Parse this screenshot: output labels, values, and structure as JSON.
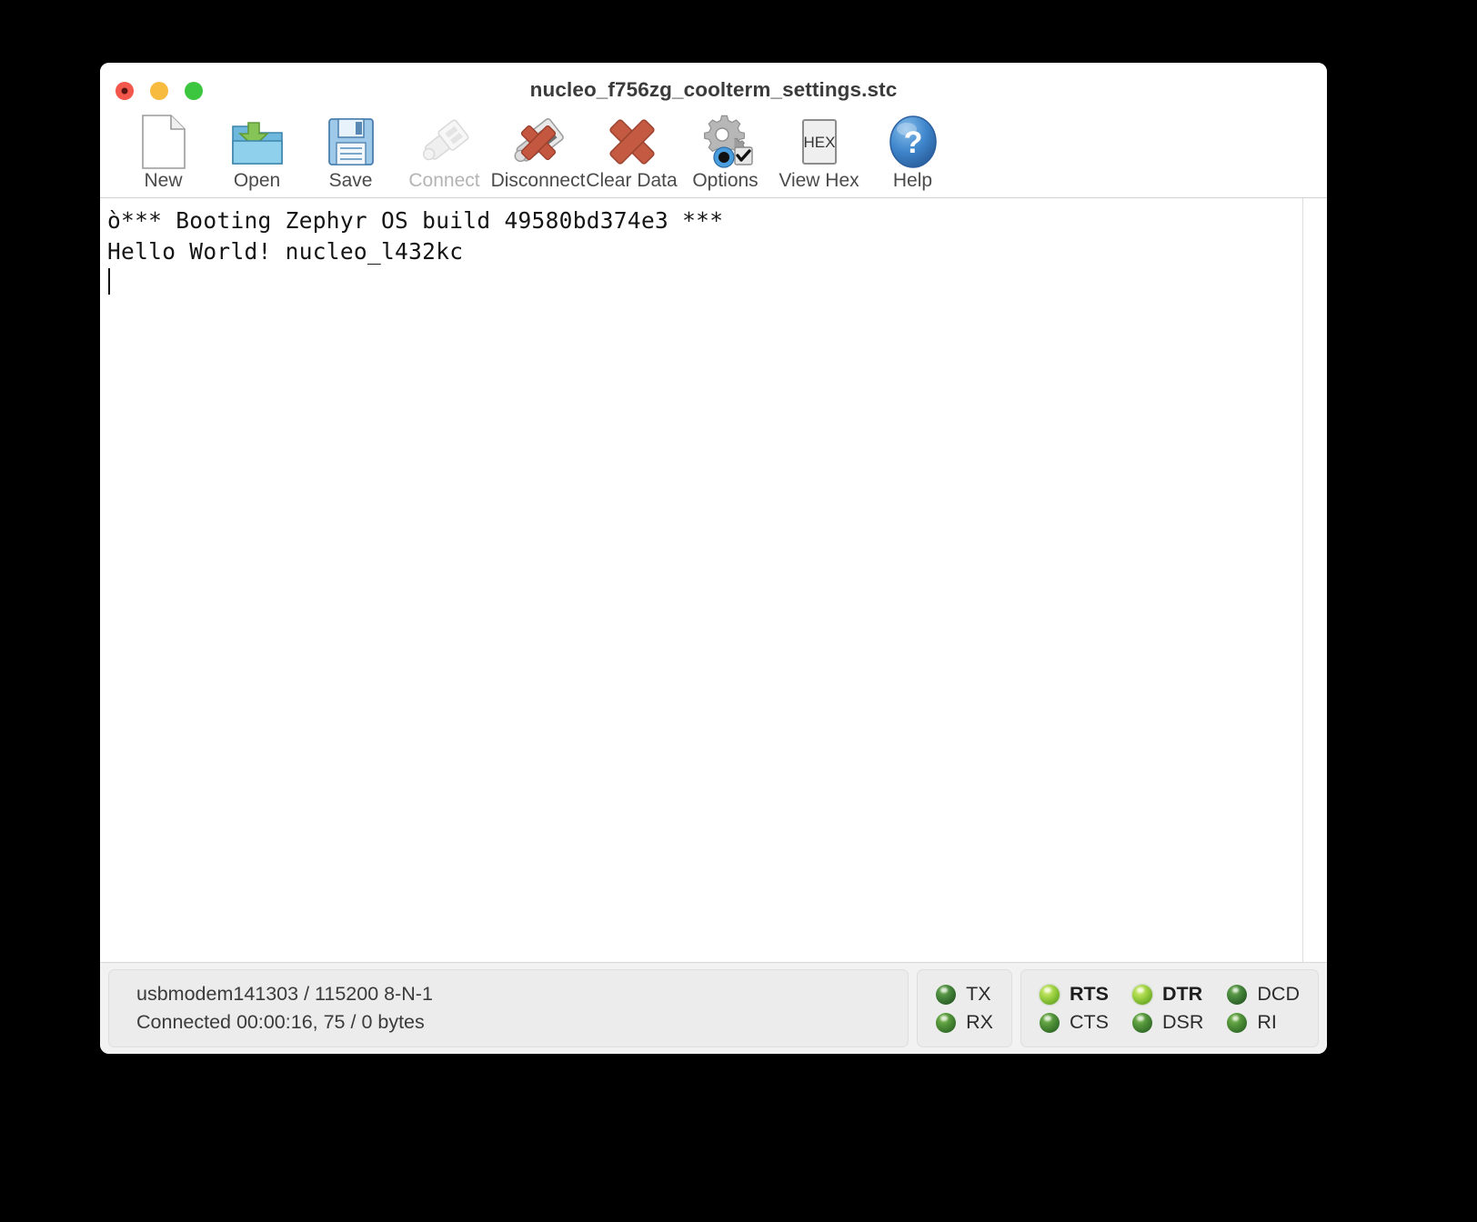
{
  "window": {
    "title": "nucleo_f756zg_coolterm_settings.stc",
    "traffic_lights": [
      {
        "name": "close",
        "color": "#f3564b"
      },
      {
        "name": "minimize",
        "color": "#f6bb3f"
      },
      {
        "name": "zoom",
        "color": "#3cc53f"
      }
    ]
  },
  "toolbar": {
    "buttons": [
      {
        "label": "New",
        "icon": "new-document-icon",
        "enabled": true
      },
      {
        "label": "Open",
        "icon": "open-folder-icon",
        "enabled": true
      },
      {
        "label": "Save",
        "icon": "floppy-disk-icon",
        "enabled": true
      },
      {
        "label": "Connect",
        "icon": "usb-plug-icon",
        "enabled": false
      },
      {
        "label": "Disconnect",
        "icon": "usb-plug-x-icon",
        "enabled": true
      },
      {
        "label": "Clear Data",
        "icon": "red-x-icon",
        "enabled": true
      },
      {
        "label": "Options",
        "icon": "gear-settings-icon",
        "enabled": true
      },
      {
        "label": "View Hex",
        "icon": "hex-button-icon",
        "enabled": true
      },
      {
        "label": "Help",
        "icon": "question-mark-icon",
        "enabled": true
      }
    ]
  },
  "terminal": {
    "lines": [
      "ò*** Booting Zephyr OS build 49580bd374e3 ***",
      "Hello World! nucleo_l432kc"
    ],
    "caret_visible": true
  },
  "status": {
    "connection": "usbmodem141303 / 115200 8-N-1",
    "state": "Connected 00:00:16, 75 / 0 bytes",
    "data_leds": [
      {
        "label": "TX",
        "state": "off",
        "bold": false
      },
      {
        "label": "RX",
        "state": "mid",
        "bold": false
      }
    ],
    "signal_leds": [
      {
        "label": "RTS",
        "state": "on",
        "bold": true
      },
      {
        "label": "CTS",
        "state": "mid",
        "bold": false
      },
      {
        "label": "DTR",
        "state": "on",
        "bold": true
      },
      {
        "label": "DSR",
        "state": "mid",
        "bold": false
      },
      {
        "label": "DCD",
        "state": "off",
        "bold": false
      },
      {
        "label": "RI",
        "state": "mid",
        "bold": false
      }
    ]
  },
  "colors": {
    "led_on": "#9ed142",
    "led_off": "#2d6327",
    "window_bg": "#ffffff",
    "statusbar_bg": "#f2f2f2",
    "desktop_bg": "#000000"
  }
}
